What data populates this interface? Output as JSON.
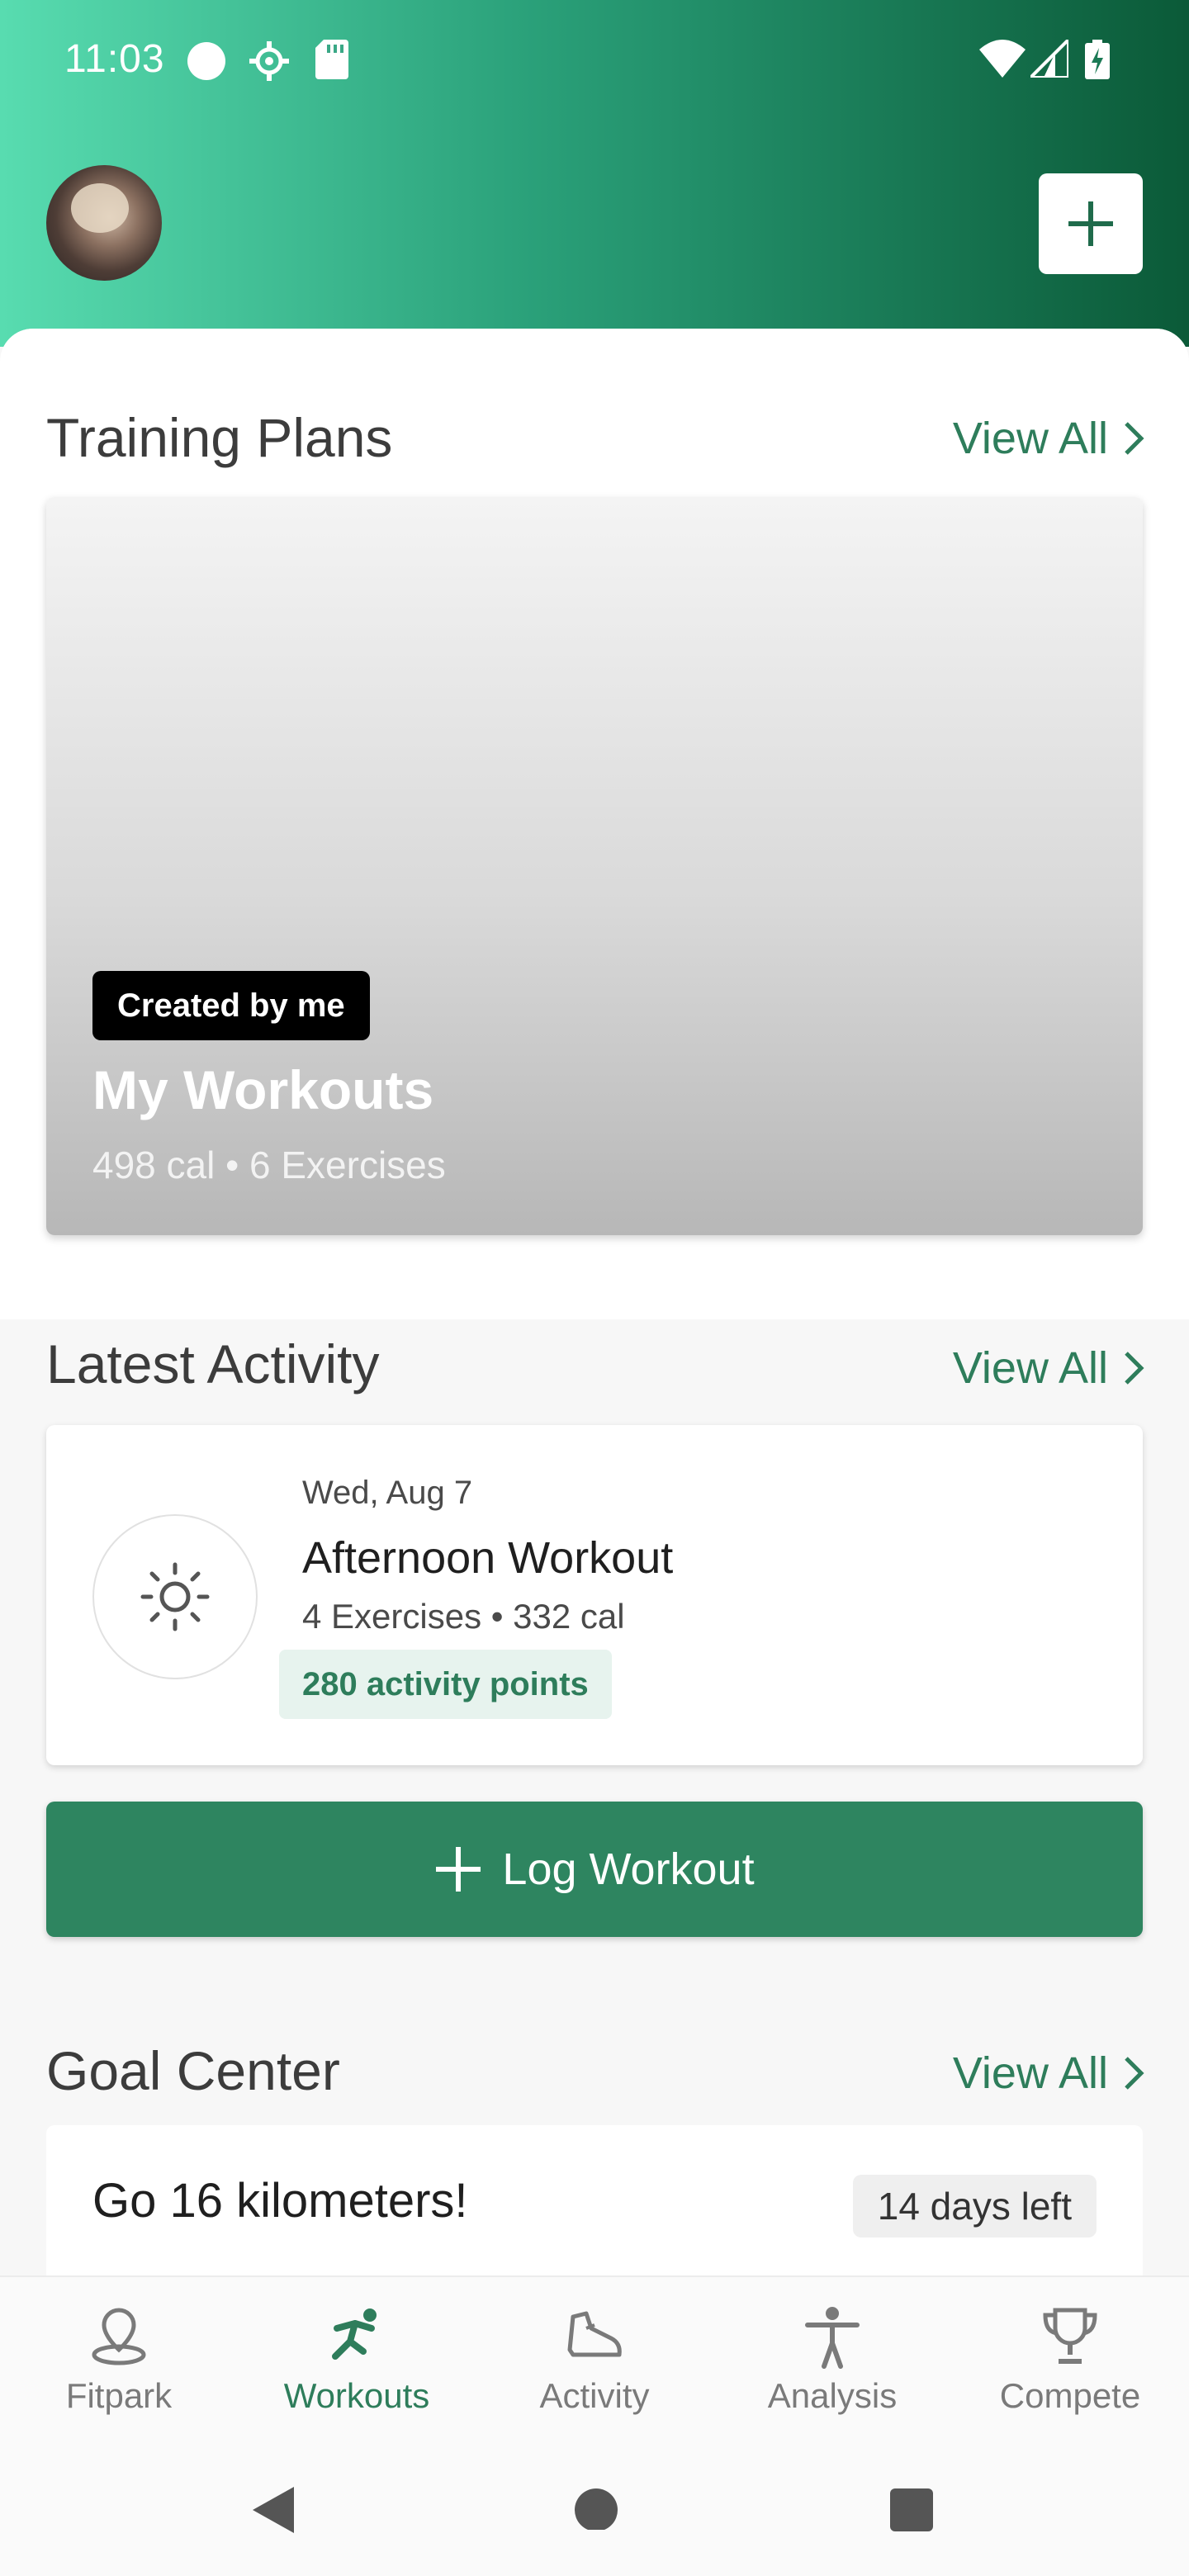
{
  "status_bar": {
    "time": "11:03"
  },
  "header": {
    "add_label": "+"
  },
  "training_plans": {
    "title": "Training Plans",
    "view_all": "View All",
    "card": {
      "badge": "Created by me",
      "title": "My Workouts",
      "meta": "498 cal • 6 Exercises"
    }
  },
  "latest_activity": {
    "title": "Latest Activity",
    "view_all": "View All",
    "card": {
      "date": "Wed, Aug 7",
      "title": "Afternoon Workout",
      "meta": "4 Exercises • 332 cal",
      "points": "280 activity points"
    }
  },
  "log_workout": {
    "label": "Log Workout"
  },
  "goal_center": {
    "title": "Goal Center",
    "view_all": "View All",
    "goal": {
      "title": "Go 16 kilometers!",
      "days_left": "14 days left"
    }
  },
  "bottom_nav": [
    {
      "label": "Fitpark",
      "icon": "location-pin-icon"
    },
    {
      "label": "Workouts",
      "icon": "runner-icon",
      "active": true
    },
    {
      "label": "Activity",
      "icon": "shoe-icon"
    },
    {
      "label": "Analysis",
      "icon": "person-icon"
    },
    {
      "label": "Compete",
      "icon": "trophy-icon"
    }
  ],
  "colors": {
    "accent": "#2e7d5b",
    "header_start": "#58dcb0",
    "header_end": "#0b5a38"
  }
}
